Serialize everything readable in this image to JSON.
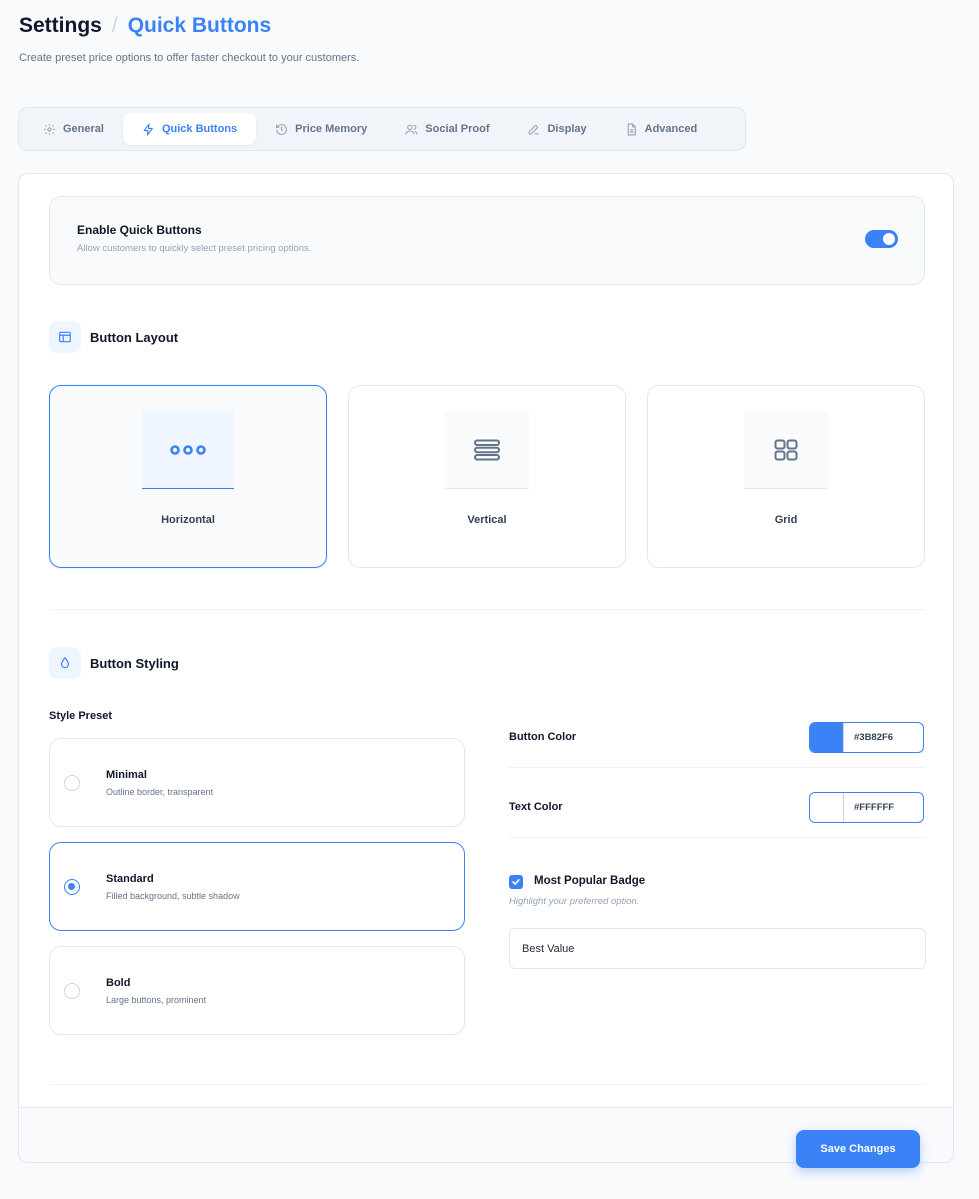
{
  "header": {
    "title": "Settings",
    "separator": "/",
    "current": "Quick Buttons",
    "subtitle": "Create preset price options to offer faster checkout to your customers."
  },
  "tabs": [
    {
      "label": "General",
      "icon": "gear-icon"
    },
    {
      "label": "Quick Buttons",
      "icon": "lightning-icon",
      "active": true
    },
    {
      "label": "Price Memory",
      "icon": "history-icon"
    },
    {
      "label": "Social Proof",
      "icon": "users-icon"
    },
    {
      "label": "Display",
      "icon": "pencil-icon"
    },
    {
      "label": "Advanced",
      "icon": "document-icon"
    }
  ],
  "enable": {
    "title": "Enable Quick Buttons",
    "description": "Allow customers to quickly select preset pricing options.",
    "enabled": true
  },
  "layout": {
    "title": "Button Layout",
    "icon": "layout-icon",
    "options": [
      {
        "label": "Horizontal",
        "icon": "dots-horizontal-icon",
        "selected": true
      },
      {
        "label": "Vertical",
        "icon": "stack-icon",
        "selected": false
      },
      {
        "label": "Grid",
        "icon": "grid-icon",
        "selected": false
      }
    ]
  },
  "styling": {
    "title": "Button Styling",
    "icon": "droplet-icon",
    "preset_label": "Style Preset",
    "presets": [
      {
        "name": "Minimal",
        "description": "Outline border, transparent",
        "selected": false
      },
      {
        "name": "Standard",
        "description": "Filled background, subtle shadow",
        "selected": true
      },
      {
        "name": "Bold",
        "description": "Large buttons, prominent",
        "selected": false
      }
    ],
    "button_color_label": "Button Color",
    "button_color": "#3B82F6",
    "text_color_label": "Text Color",
    "text_color": "#FFFFFF",
    "badge_label": "Most Popular Badge",
    "badge_checked": true,
    "badge_hint": "Highlight your preferred option.",
    "badge_text": "Best Value"
  },
  "actions": {
    "save_label": "Save Changes"
  },
  "colors": {
    "accent": "#3b82f6",
    "border": "#e2e8f0",
    "background": "#f8fafc"
  }
}
